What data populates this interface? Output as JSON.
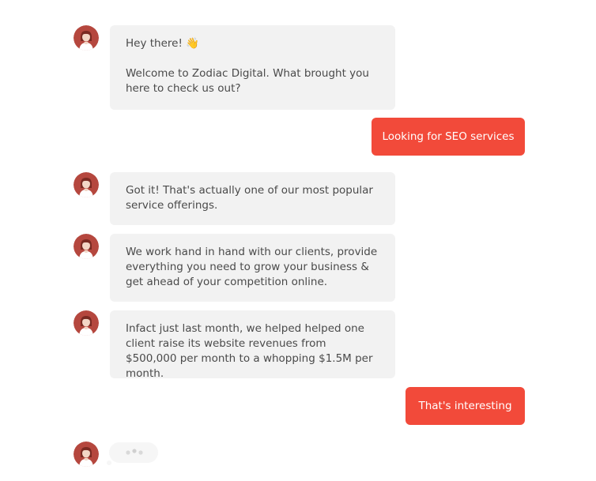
{
  "chat": {
    "bot_greeting_line1": "Hey there! 👋",
    "bot_greeting_line2": "Welcome to Zodiac Digital. What brought you here to check us out?",
    "user_reply_1": "Looking for SEO services",
    "bot_reply_1": "Got it! That's actually one of our most popular service offerings.",
    "bot_reply_2": "We work hand in hand with our clients, provide everything you need to grow your business & get ahead of your competition online.",
    "bot_reply_3": "Infact just last month, we helped helped one client raise its website revenues from $500,000 per month to a whopping $1.5M per month.",
    "user_reply_2": "That's interesting"
  },
  "icons": {
    "bot_avatar": "avatar-woman-icon",
    "typing": "typing-indicator-icon"
  },
  "colors": {
    "accent": "#f24a3a",
    "bot_bubble": "#f2f2f2",
    "avatar_bg": "#b5473e"
  }
}
